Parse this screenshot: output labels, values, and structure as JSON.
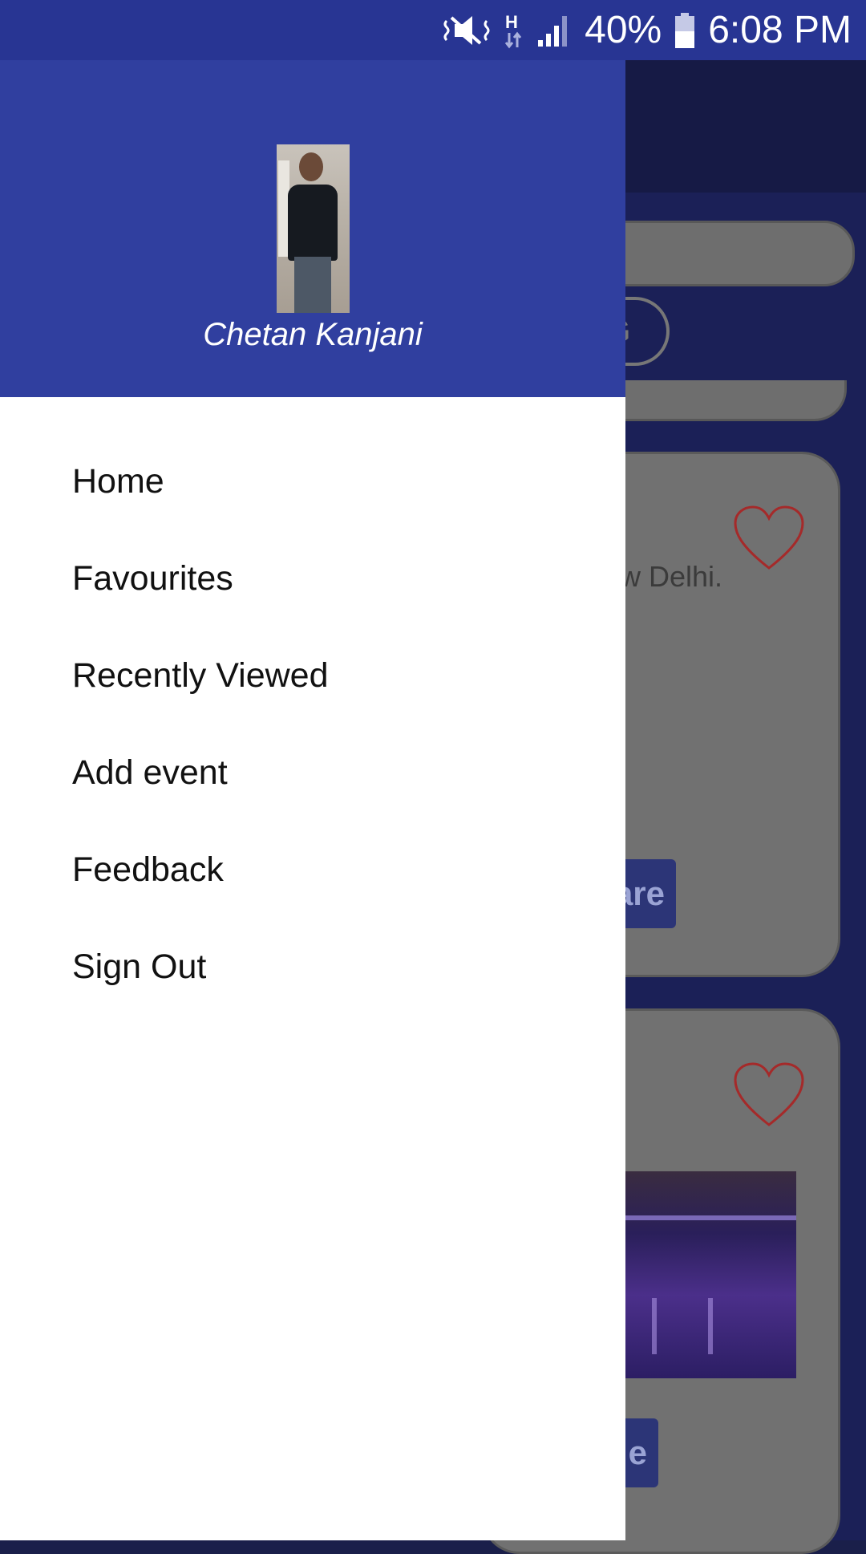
{
  "status_bar": {
    "battery": "40%",
    "time": "6:08 PM",
    "icons": [
      "mute-icon",
      "data-h-icon",
      "signal-icon",
      "battery-icon"
    ]
  },
  "drawer": {
    "user_name": "Chetan Kanjani",
    "header_color": "#303f9f",
    "menu": [
      {
        "label": "Home"
      },
      {
        "label": "Favourites"
      },
      {
        "label": "Recently Viewed"
      },
      {
        "label": "Add event"
      },
      {
        "label": "Feedback"
      },
      {
        "label": "Sign Out"
      }
    ]
  },
  "background": {
    "chip_label": "G",
    "card1": {
      "location_text": "ew Delhi.",
      "button_label": "are"
    },
    "card2": {
      "button_label": "e"
    }
  },
  "colors": {
    "status_bar": "#283593",
    "primary": "#303f9f",
    "heart": "#c62828"
  }
}
